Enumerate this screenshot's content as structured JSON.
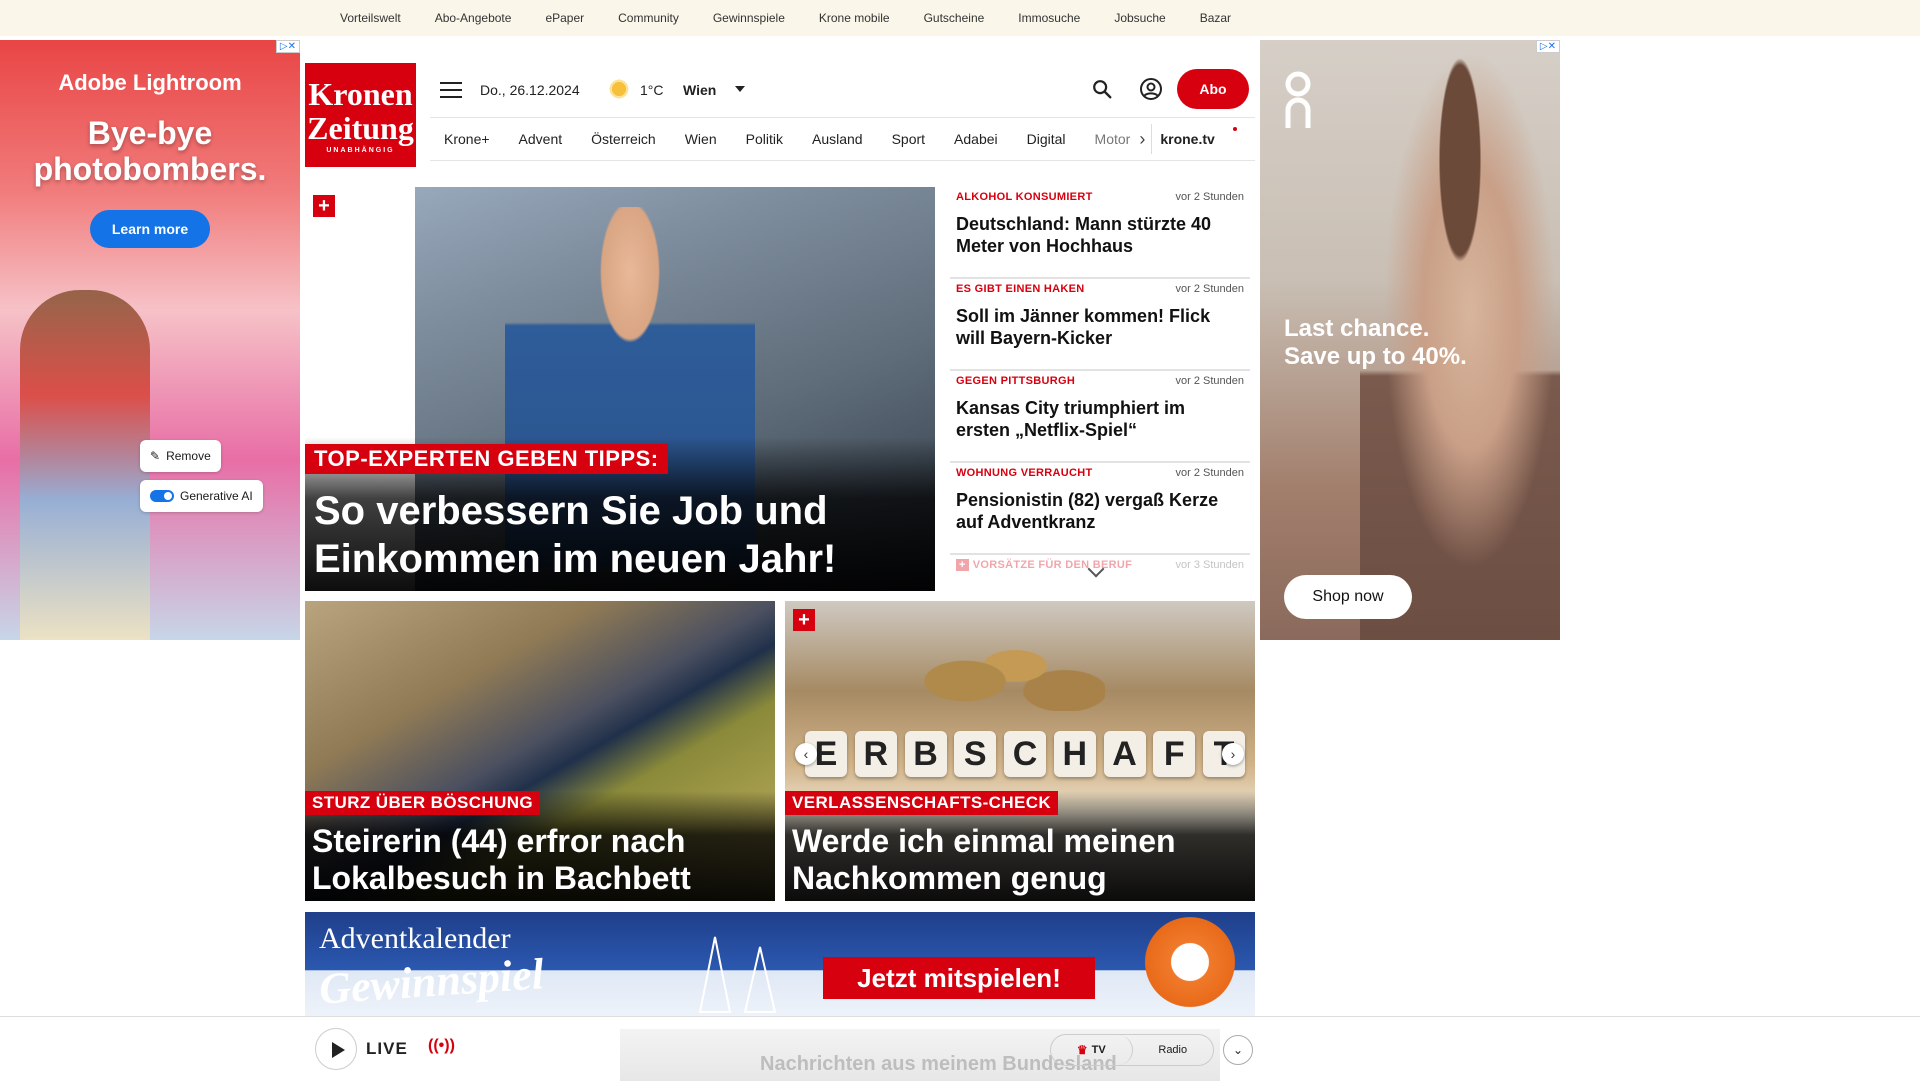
{
  "topbar": {
    "links": [
      "Vorteilswelt",
      "Abo-Angebote",
      "ePaper",
      "Community",
      "Gewinnspiele",
      "Krone mobile",
      "Gutscheine",
      "Immosuche",
      "Jobsuche",
      "Bazar"
    ]
  },
  "ad_left": {
    "brand": "Adobe Lightroom",
    "headline_1": "Bye-bye",
    "headline_2": "photobombers.",
    "cta": "Learn more",
    "pill_remove": "Remove",
    "pill_genai": "Generative AI"
  },
  "ad_right": {
    "logo": "On",
    "slogan_1": "Last chance.",
    "slogan_2": "Save up to 40%.",
    "cta": "Shop now"
  },
  "header": {
    "logo_1": "Kronen",
    "logo_2": "Zeitung",
    "logo_3": "UNABHÄNGIG",
    "date": "Do., 26.12.2024",
    "temperature": "1°C",
    "city": "Wien",
    "abo_label": "Abo"
  },
  "nav": {
    "items": [
      "Krone+",
      "Advent",
      "Österreich",
      "Wien",
      "Politik",
      "Ausland",
      "Sport",
      "Adabei",
      "Digital",
      "Motor"
    ],
    "tv": "krone.tv"
  },
  "hero": {
    "kicker": "TOP-EXPERTEN GEBEN TIPPS:",
    "title_1": "So verbessern Sie Job und",
    "title_2": "Einkommen im neuen Jahr!"
  },
  "feed": [
    {
      "kicker": "ALKOHOL KONSUMIERT",
      "time": "vor 2 Stunden",
      "title": "Deutschland: Mann stürzte 40 Meter von Hochhaus"
    },
    {
      "kicker": "ES GIBT EINEN HAKEN",
      "time": "vor 2 Stunden",
      "title": "Soll im Jänner kommen! Flick will Bayern-Kicker"
    },
    {
      "kicker": "GEGEN PITTSBURGH",
      "time": "vor 2 Stunden",
      "title": "Kansas City triumphiert im ersten „Netflix-Spiel“"
    },
    {
      "kicker": "WOHNUNG VERRAUCHT",
      "time": "vor 2 Stunden",
      "title": "Pensionistin (82) vergaß Kerze auf Adventkranz"
    },
    {
      "kicker": "VORSÄTZE FÜR DEN BERUF",
      "time": "vor 3 Stunden",
      "title": ""
    }
  ],
  "card1": {
    "kicker": "STURZ ÜBER BÖSCHUNG",
    "title_1": "Steirerin (44) erfror nach",
    "title_2": "Lokalbesuch in Bachbett"
  },
  "card2": {
    "kicker": "VERLASSENSCHAFTS-CHECK",
    "title_1": "Werde ich einmal meinen",
    "title_2": "Nachkommen genug vererben?",
    "letters": [
      "E",
      "R",
      "B",
      "S",
      "C",
      "H",
      "A",
      "F",
      "T"
    ]
  },
  "banner": {
    "line_1": "Adventkalender",
    "line_2": "Gewinnspiel",
    "cta": "Jetzt mitspielen!"
  },
  "player": {
    "live": "LIVE",
    "tv": "TV",
    "radio": "Radio",
    "teaser": "Nachrichten aus meinem Bundesland"
  }
}
